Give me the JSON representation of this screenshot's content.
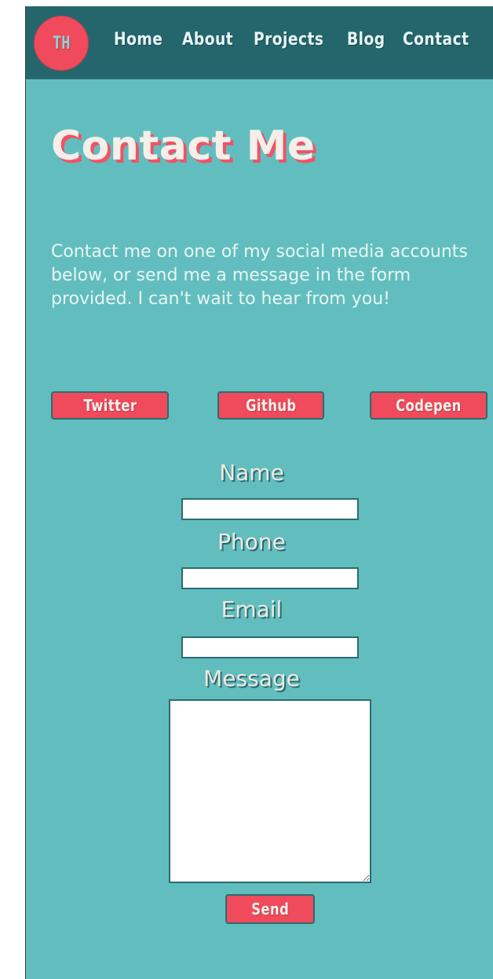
{
  "logo": {
    "initials": "TH"
  },
  "nav": {
    "items": [
      {
        "label": "Home"
      },
      {
        "label": "About"
      },
      {
        "label": "Projects"
      },
      {
        "label": "Blog"
      },
      {
        "label": "Contact"
      }
    ]
  },
  "page": {
    "title": "Contact Me",
    "intro": "Contact me on one of my social media accounts below, or send me a message in the form provided. I can't wait to hear from you!"
  },
  "social": {
    "buttons": [
      {
        "label": "Twitter"
      },
      {
        "label": "Github"
      },
      {
        "label": "Codepen"
      }
    ]
  },
  "form": {
    "name_label": "Name",
    "phone_label": "Phone",
    "email_label": "Email",
    "message_label": "Message",
    "name_value": "",
    "phone_value": "",
    "email_value": "",
    "message_value": "",
    "send_label": "Send"
  },
  "colors": {
    "nav_bg": "#25666d",
    "page_bg": "#62bebe",
    "accent": "#f04a5d",
    "text_light": "#eaf6f6",
    "outline_dark": "#2b6c71"
  }
}
